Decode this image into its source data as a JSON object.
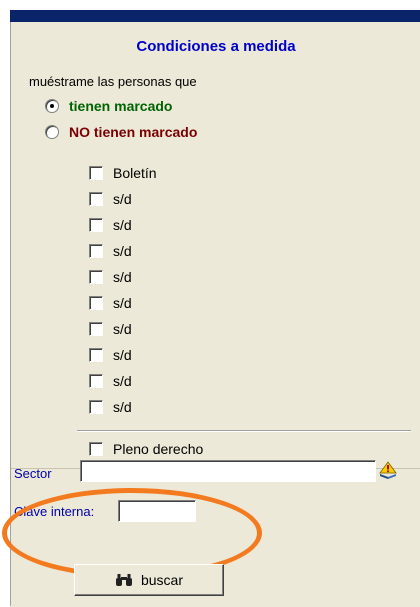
{
  "panel": {
    "title": "Condiciones a medida",
    "subtitle": "muéstrame las personas que"
  },
  "radios": [
    {
      "label": "tienen marcado",
      "selected": true,
      "color": "#006400"
    },
    {
      "label": "NO tienen marcado",
      "selected": false,
      "color": "#7b0000"
    }
  ],
  "checkboxes": [
    {
      "label": "Boletín",
      "checked": false
    },
    {
      "label": "s/d",
      "checked": false
    },
    {
      "label": "s/d",
      "checked": false
    },
    {
      "label": "s/d",
      "checked": false
    },
    {
      "label": "s/d",
      "checked": false
    },
    {
      "label": "s/d",
      "checked": false
    },
    {
      "label": "s/d",
      "checked": false
    },
    {
      "label": "s/d",
      "checked": false
    },
    {
      "label": "s/d",
      "checked": false
    },
    {
      "label": "s/d",
      "checked": false
    }
  ],
  "pleno": {
    "label": "Pleno derecho",
    "checked": false
  },
  "fields": {
    "sector_label": "Sector",
    "sector_value": "",
    "clave_label": "Clave interna:",
    "clave_value": ""
  },
  "buttons": {
    "search_label": "buscar"
  },
  "colors": {
    "title": "#0000cc",
    "highlight": "#f47a20",
    "topbar": "#0a246a"
  },
  "icons": {
    "lookup": "help-book-icon",
    "search": "binoculars-icon"
  }
}
